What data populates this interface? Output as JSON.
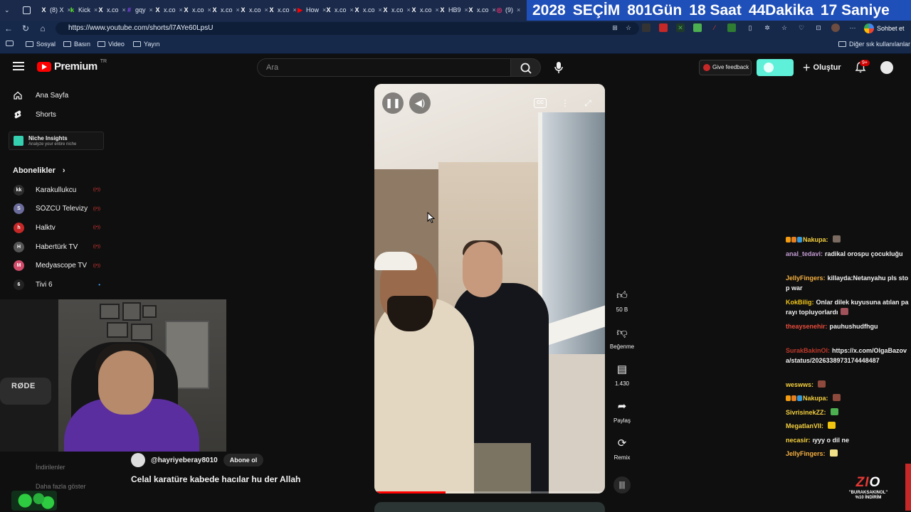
{
  "browser": {
    "tabs": [
      {
        "icon": "x-icon",
        "text": "(8) X"
      },
      {
        "icon": "kick-icon",
        "text": "Kick"
      },
      {
        "icon": "x-icon",
        "text": "x.co"
      },
      {
        "icon": "twitch-icon",
        "text": "gqy"
      },
      {
        "icon": "x-icon",
        "text": "x.co"
      },
      {
        "icon": "x-icon",
        "text": "x.co"
      },
      {
        "icon": "x-icon",
        "text": "x.co"
      },
      {
        "icon": "x-icon",
        "text": "x.co"
      },
      {
        "icon": "x-icon",
        "text": "x.co"
      },
      {
        "icon": "youtube-icon",
        "text": "How"
      },
      {
        "icon": "x-icon",
        "text": "x.co"
      },
      {
        "icon": "x-icon",
        "text": "x.co"
      },
      {
        "icon": "x-icon",
        "text": "x.co"
      },
      {
        "icon": "x-icon",
        "text": "x.co"
      },
      {
        "icon": "x-icon",
        "text": "HB9"
      },
      {
        "icon": "x-icon",
        "text": "x.co"
      },
      {
        "icon": "instagram-icon",
        "text": "(9)"
      }
    ],
    "countdown": [
      "2028",
      "SEÇİM",
      "801Gün",
      "18 Saat",
      "44Dakika",
      "17 Saniye"
    ],
    "url": "https://www.youtube.com/shorts/l7AYe60LpsU",
    "chat_button": "Sohbet et",
    "bookmarks": [
      "Sosyal",
      "Basın",
      "Video",
      "Yayın"
    ],
    "other_bookmarks": "Diğer sık kullanılanlar"
  },
  "header": {
    "logo_text": "Premium",
    "logo_region": "TR",
    "search_placeholder": "Ara",
    "feedback_label": "Give feedback",
    "create_label": "Oluştur",
    "notification_count": "9+"
  },
  "sidebar": {
    "items": [
      {
        "label": "Ana Sayfa",
        "icon": "home-icon"
      },
      {
        "label": "Shorts",
        "icon": "shorts-icon"
      }
    ],
    "niche": {
      "title": "Niche Insights",
      "subtitle": "Analyze your entire niche"
    },
    "subscriptions_title": "Abonelikler",
    "subscriptions": [
      {
        "name": "Karakullukcu",
        "avatar": "kk",
        "color": "#2d2d2d"
      },
      {
        "name": "SÖZCÜ Televizyo...",
        "avatar": "S",
        "color": "#6c6c9c"
      },
      {
        "name": "Halktv",
        "avatar": "h",
        "color": "#c62828"
      },
      {
        "name": "Habertürk TV",
        "avatar": "H",
        "color": "#555555"
      },
      {
        "name": "Medyascope TV",
        "avatar": "M",
        "color": "#d14b6b"
      },
      {
        "name": "Tivi 6",
        "avatar": "6",
        "color": "#222222"
      }
    ],
    "faded_items": [
      "İndirilenler",
      "Daha fazla göster"
    ]
  },
  "webcam": {
    "mic_brand": "RØDE"
  },
  "video": {
    "progress": 0.31,
    "actions": [
      {
        "icon": "like-icon",
        "label": "50 B"
      },
      {
        "icon": "dislike-icon",
        "label": "Beğenme"
      },
      {
        "icon": "comment-icon",
        "label": "1.430"
      },
      {
        "icon": "share-icon",
        "label": "Paylaş"
      },
      {
        "icon": "remix-icon",
        "label": "Remix"
      }
    ],
    "channel": "@hayriyeberay8010",
    "subscribe_label": "Abone ol",
    "title": "Celal karatüre kabede hacılar hu der Allah"
  },
  "chat": [
    {
      "nick": "Nakupa:",
      "color": "#f4d03f",
      "text": "",
      "badges": true,
      "emote": "#7a6a60"
    },
    {
      "nick": "anal_tedavi:",
      "color": "#c39bd3",
      "text": "radikal orospu çocukluğu"
    },
    {
      "nick": "JellyFingers:",
      "color": "#f5b041",
      "text": "killayda:Netanyahu pls stop war"
    },
    {
      "nick": "KokBilig:",
      "color": "#f0c419",
      "text": "Onlar dilek kuyusuna atılan parayı topluyorlardı",
      "emote": "#a0525a"
    },
    {
      "nick": "theaysenehir:",
      "color": "#e74c3c",
      "text": "pauhushudfhgu"
    },
    {
      "nick": "SurakBakinOl:",
      "color": "#c0392b",
      "text": "https://x.com/OlgaBazova/status/2026338973174448487"
    },
    {
      "nick": "weswws:",
      "color": "#f4d03f",
      "text": "",
      "emote": "#8d4a3c"
    },
    {
      "nick": "Nakupa:",
      "color": "#f4d03f",
      "text": "",
      "badges": true,
      "emote": "#8d4a3c"
    },
    {
      "nick": "SivrisinekZZ:",
      "color": "#f4d03f",
      "text": "",
      "emote": "#4caf50"
    },
    {
      "nick": "MegatlanVII:",
      "color": "#f4d03f",
      "text": "",
      "emote": "#f1c40f"
    },
    {
      "nick": "necasir:",
      "color": "#f4d03f",
      "text": "ıyyy o dil ne"
    },
    {
      "nick": "JellyFingers:",
      "color": "#f5b041",
      "text": "",
      "emote": "#f1e08a"
    }
  ],
  "promo": {
    "brand_left": "Z",
    "brand_mid": "I",
    "brand_right": "O",
    "line1": "\"BURAKSAKINOL\"",
    "line2": "%10 İNDİRİM"
  }
}
